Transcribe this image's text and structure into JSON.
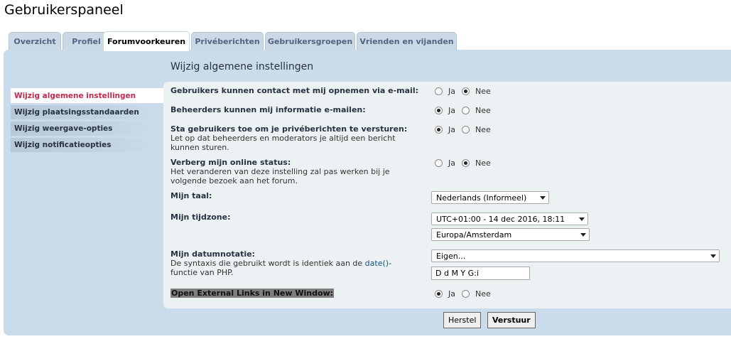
{
  "page": {
    "title": "Gebruikerspaneel"
  },
  "tabs": [
    {
      "label": "Overzicht"
    },
    {
      "label": "Profiel"
    },
    {
      "label": "Forumvoorkeuren"
    },
    {
      "label": "Privéberichten"
    },
    {
      "label": "Gebruikersgroepen"
    },
    {
      "label": "Vrienden en vijanden"
    }
  ],
  "sidebar": {
    "items": [
      {
        "label": "Wijzig algemene instellingen",
        "active": true
      },
      {
        "label": "Wijzig plaatsingsstandaarden"
      },
      {
        "label": "Wijzig weergave-opties"
      },
      {
        "label": "Wijzig notificatieopties"
      }
    ]
  },
  "main": {
    "title": "Wijzig algemene instellingen",
    "yes_label": "Ja",
    "no_label": "Nee",
    "settings": {
      "contact_email": {
        "label": "Gebruikers kunnen contact met mij opnemen via e-mail:",
        "value": "Nee"
      },
      "admin_email": {
        "label": "Beheerders kunnen mij informatie e-mailen:",
        "value": "Ja"
      },
      "allow_pm": {
        "label": "Sta gebruikers toe om je privéberichten te versturen:",
        "explain": "Let op dat beheerders en moderators je altijd een bericht kunnen sturen.",
        "value": "Ja"
      },
      "hide_online": {
        "label": "Verberg mijn online status:",
        "explain": "Het veranderen van deze instelling zal pas werken bij je volgende bezoek aan het forum.",
        "value": "Nee"
      },
      "language": {
        "label": "Mijn taal:",
        "value": "Nederlands (Informeel)"
      },
      "timezone": {
        "label": "Mijn tijdzone:",
        "offset_value": "UTC+01:00 - 14 dec 2016, 18:11",
        "zone_value": "Europa/Amsterdam"
      },
      "dateformat": {
        "label": "Mijn datumnotatie:",
        "explain_before": "De syntaxis die gebruikt wordt is identiek aan de ",
        "explain_link": "date()",
        "explain_after": "-functie van PHP.",
        "select_value": "Eigen...",
        "custom_value": "D d M Y G:i"
      },
      "external_links": {
        "label": "Open External Links in New Window:",
        "value": "Ja"
      }
    }
  },
  "buttons": {
    "reset": "Herstel",
    "submit": "Verstuur"
  }
}
